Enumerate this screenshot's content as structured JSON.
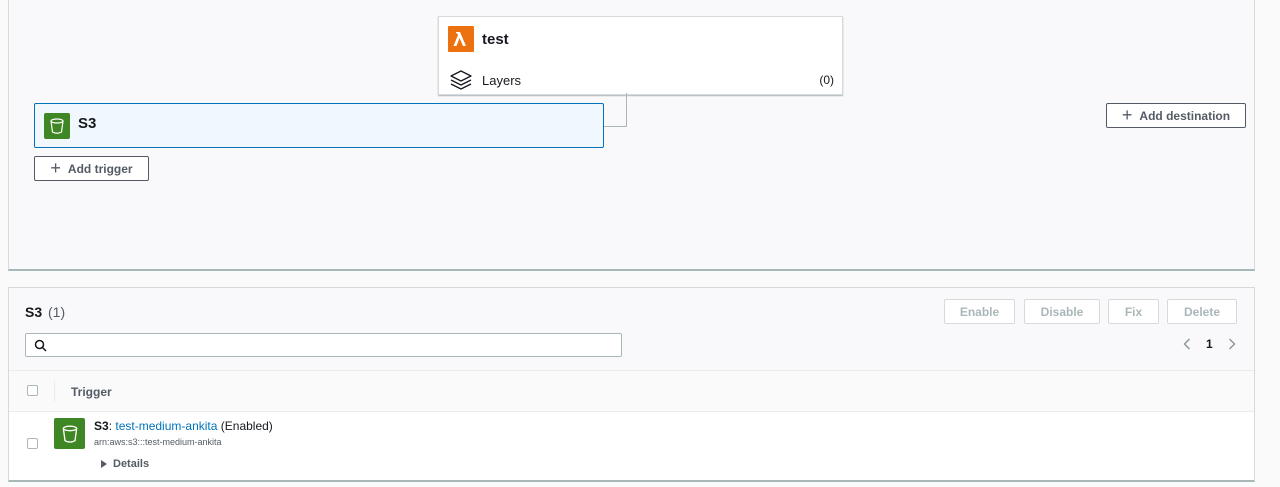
{
  "designer": {
    "function_name": "test",
    "layers_label": "Layers",
    "layers_count": "(0)",
    "trigger_name": "S3",
    "add_trigger_label": "Add trigger",
    "add_destination_label": "Add destination"
  },
  "triggers_panel": {
    "title": "S3",
    "count": "(1)",
    "actions": {
      "enable": "Enable",
      "disable": "Disable",
      "fix": "Fix",
      "delete": "Delete"
    },
    "search_value": "",
    "page": "1",
    "column_trigger": "Trigger",
    "rows": [
      {
        "service": "S3",
        "separator": ":",
        "bucket": "test-medium-ankita",
        "state": "(Enabled)",
        "arn": "arn:aws:s3:::test-medium-ankita",
        "details_label": "Details"
      }
    ]
  },
  "colors": {
    "lambda_orange": "#ec7211",
    "s3_green": "#3f8624",
    "link_blue": "#0073bb"
  },
  "icons": [
    "lambda-icon",
    "layers-icon",
    "s3-bucket-icon",
    "plus-icon",
    "search-icon",
    "chevron-left-icon",
    "chevron-right-icon",
    "caret-right-icon"
  ]
}
